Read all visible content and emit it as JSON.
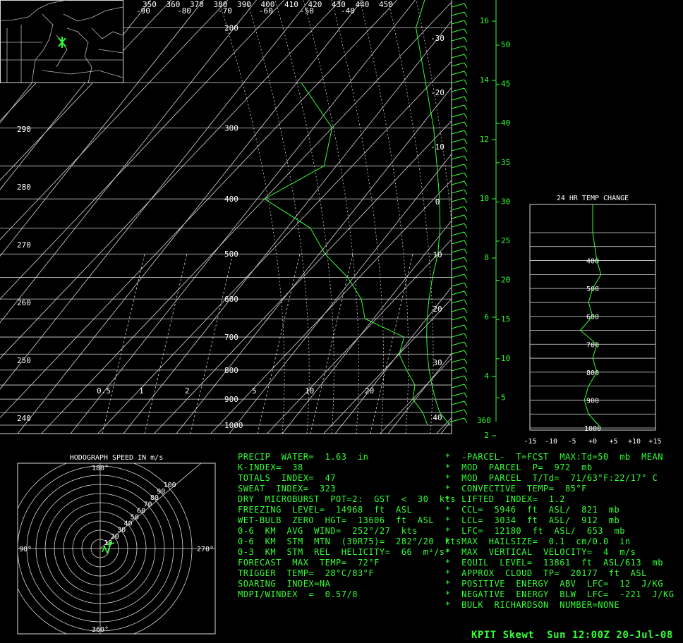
{
  "footer": {
    "station": "KPIT",
    "product": "Skewt",
    "time": "Sun 12:00Z 20-Jul-08"
  },
  "hodograph": {
    "title": "HODOGRAPH SPEED IN m/s",
    "top_label": "180°",
    "bottom_label": "360°",
    "left_label": "90°",
    "right_label": "270°",
    "ring_labels": [
      "10",
      "20",
      "30",
      "40",
      "50",
      "60",
      "70",
      "80",
      "90",
      "100"
    ]
  },
  "temp_change": {
    "title": "24 HR TEMP CHANGE",
    "x_ticks": [
      "-15",
      "-10",
      "-5",
      "+0",
      "+5",
      "+10",
      "+15"
    ],
    "p_labels": [
      "400",
      "500",
      "600",
      "700",
      "800",
      "900",
      "1000"
    ]
  },
  "skewt_labels": {
    "top_theta": [
      "350",
      "360",
      "370",
      "380",
      "390",
      "400",
      "410",
      "420",
      "430",
      "440",
      "450"
    ],
    "top_temp": [
      "-90",
      "-80",
      "-70",
      "-60",
      "-50",
      "-40"
    ],
    "left_theta": [
      "290",
      "280",
      "270",
      "260",
      "250",
      "240"
    ],
    "pressure": [
      "200",
      "300",
      "400",
      "500",
      "600",
      "700",
      "800",
      "900",
      "1000"
    ],
    "mixing": [
      "0.5",
      "1",
      "2",
      "5",
      "10",
      "20"
    ],
    "diag_temps": [
      "-30",
      "-20",
      "-10",
      "0",
      "10",
      "20",
      "30",
      "40"
    ],
    "km": [
      "16",
      "14",
      "12",
      "10",
      "8",
      "6",
      "4",
      "2"
    ],
    "kft": [
      "50",
      "45",
      "40",
      "35",
      "30",
      "25",
      "20",
      "15",
      "10",
      "5"
    ],
    "bottom_right": "360"
  },
  "stats_left": [
    "PRECIP  WATER=  1.63  in",
    "K-INDEX=  38",
    "TOTALS  INDEX=  47",
    "SWEAT  INDEX=  323",
    "DRY  MICROBURST  POT=2:  GST  <  30  kts",
    "FREEZING  LEVEL=  14968  ft  ASL",
    "WET-BULB  ZERO  HGT=  13606  ft  ASL",
    "0-6  KM  AVG  WIND=  252°/27  kts",
    "0-6  KM  STM  MTN  (30R75)=  282°/20  kts",
    "0-3  KM  STM  REL  HELICITY=  66  m²/s²",
    "FORECAST  MAX  TEMP=  72°F",
    "TRIGGER  TEMP=  28°C/83°F",
    "SOARING  INDEX=NA",
    "MDPI/WINDEX  =  0.57/8"
  ],
  "stats_right": [
    "*  -PARCEL-  T=FCST  MAX:Td=50  mb  MEAN",
    "*  MOD  PARCEL  P=  972  mb",
    "*  MOD  PARCEL  T/Td=  71/63°F:22/17° C",
    "*  CONVECTIVE  TEMP=  85°F",
    "*  LIFTED  INDEX=  1.2",
    "*  CCL=  5946  ft  ASL/  821  mb",
    "*  LCL=  3034  ft  ASL/  912  mb",
    "*  LFC=  12180  ft  ASL/  653  mb",
    "*  MAX  HAILSIZE=  0.1  cm/0.0  in",
    "*  MAX  VERTICAL  VELOCITY=  4  m/s",
    "*  EQUIL  LEVEL=  13861  ft  ASL/613  mb",
    "*  APPROX  CLOUD  TP=  20177  ft  ASL",
    "*  POSITIVE  ENERGY  ABV  LFC=  12  J/KG",
    "*  NEGATIVE  ENERGY  BLW  LFC=  -221  J/KG",
    "*  BULK  RICHARDSON  NUMBER=NONE"
  ],
  "chart_data": {
    "type": "line",
    "series": [
      {
        "values": [
          [
            1000,
            21
          ],
          [
            950,
            17
          ],
          [
            900,
            14
          ],
          [
            850,
            11
          ],
          [
            800,
            8
          ],
          [
            750,
            5
          ],
          [
            700,
            2
          ],
          [
            650,
            -1
          ],
          [
            600,
            -4
          ],
          [
            550,
            -7
          ],
          [
            500,
            -10
          ],
          [
            450,
            -14
          ],
          [
            400,
            -19
          ],
          [
            350,
            -25
          ],
          [
            300,
            -32
          ],
          [
            250,
            -41
          ],
          [
            200,
            -52
          ],
          [
            150,
            -60
          ],
          [
            100,
            -63
          ]
        ]
      },
      {
        "values": [
          [
            1000,
            17
          ],
          [
            950,
            14
          ],
          [
            900,
            10
          ],
          [
            850,
            8
          ],
          [
            800,
            4
          ],
          [
            750,
            0
          ],
          [
            700,
            -2
          ],
          [
            650,
            -12
          ],
          [
            600,
            -16
          ],
          [
            550,
            -22
          ],
          [
            500,
            -30
          ],
          [
            450,
            -37
          ],
          [
            400,
            -50
          ],
          [
            350,
            -45
          ],
          [
            300,
            -50
          ],
          [
            250,
            -63
          ]
        ]
      }
    ],
    "colors": {
      "grid": "#d8d8d8",
      "trace": "#33ff33"
    }
  },
  "temp_change_data": {
    "pressure": [
      300,
      350,
      400,
      450,
      500,
      550,
      600,
      650,
      700,
      750,
      800,
      850,
      900,
      950,
      1000
    ],
    "delta": [
      0,
      0.5,
      1,
      2,
      0,
      -1,
      0,
      -3,
      1,
      0,
      1,
      -1,
      -2,
      -1,
      2
    ]
  }
}
